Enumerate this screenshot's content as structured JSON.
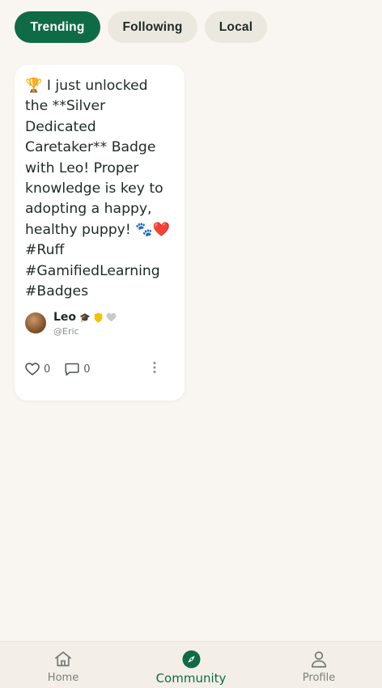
{
  "tabs": [
    {
      "label": "Trending",
      "active": true
    },
    {
      "label": "Following",
      "active": false
    },
    {
      "label": "Local",
      "active": false
    }
  ],
  "post": {
    "text": "🏆 I just unlocked the **Silver Dedicated Caretaker** Badge with Leo! Proper knowledge is key to adopting a happy, healthy puppy! 🐾❤️ #Ruff #GamifiedLearning #Badges",
    "author": {
      "name": "Leo",
      "handle": "@Eric",
      "badges": [
        "graduation-cap",
        "gold-shield",
        "gray-heart"
      ]
    },
    "likes": "0",
    "comments": "0"
  },
  "nav": {
    "items": [
      {
        "label": "Home",
        "icon": "home-icon",
        "active": false
      },
      {
        "label": "Community",
        "icon": "compass-icon",
        "active": true
      },
      {
        "label": "Profile",
        "icon": "person-icon",
        "active": false
      }
    ]
  },
  "colors": {
    "accent": "#0f6b46",
    "background": "#f9f6f1",
    "chip": "#ebe8e0",
    "shield": "#f2c300"
  }
}
